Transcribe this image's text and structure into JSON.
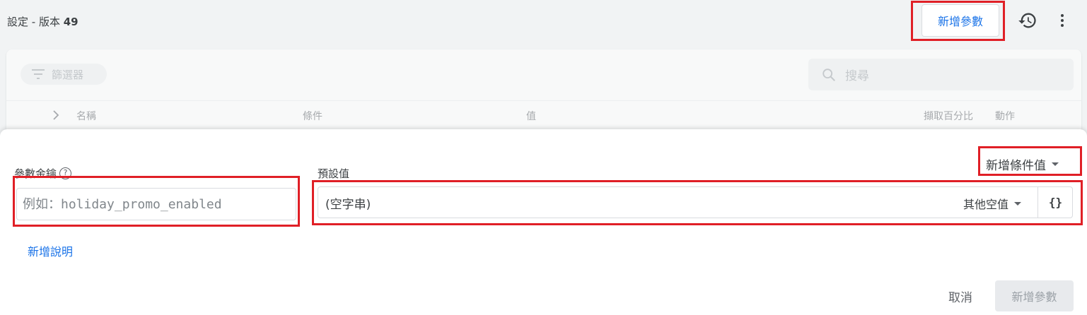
{
  "header": {
    "breadcrumb_prefix": "設定 - 版本 ",
    "version": "49",
    "add_param_label": "新增參數",
    "history_icon": "history-icon",
    "more_icon": "more-vert-icon"
  },
  "table": {
    "filter_label": "篩選器",
    "search_placeholder": "搜尋",
    "columns": {
      "name": "名稱",
      "condition": "條件",
      "value": "值",
      "fetch_percent": "擷取百分比",
      "actions": "動作"
    }
  },
  "form": {
    "key_label": "參數金鑰",
    "key_placeholder": "例如：holiday_promo_enabled",
    "key_value": "",
    "default_label": "預設值",
    "add_condition_label": "新增條件值",
    "default_value_text": "(空字串)",
    "value_type_label": "其他空值",
    "json_button_label": "{}",
    "add_description_label": "新增說明",
    "cancel_label": "取消",
    "submit_label": "新增參數"
  },
  "colors": {
    "accent": "#1a73e8",
    "highlight": "#e01f26",
    "page_bg": "#f1f3f4",
    "disabled_bg": "#e8eaed"
  }
}
